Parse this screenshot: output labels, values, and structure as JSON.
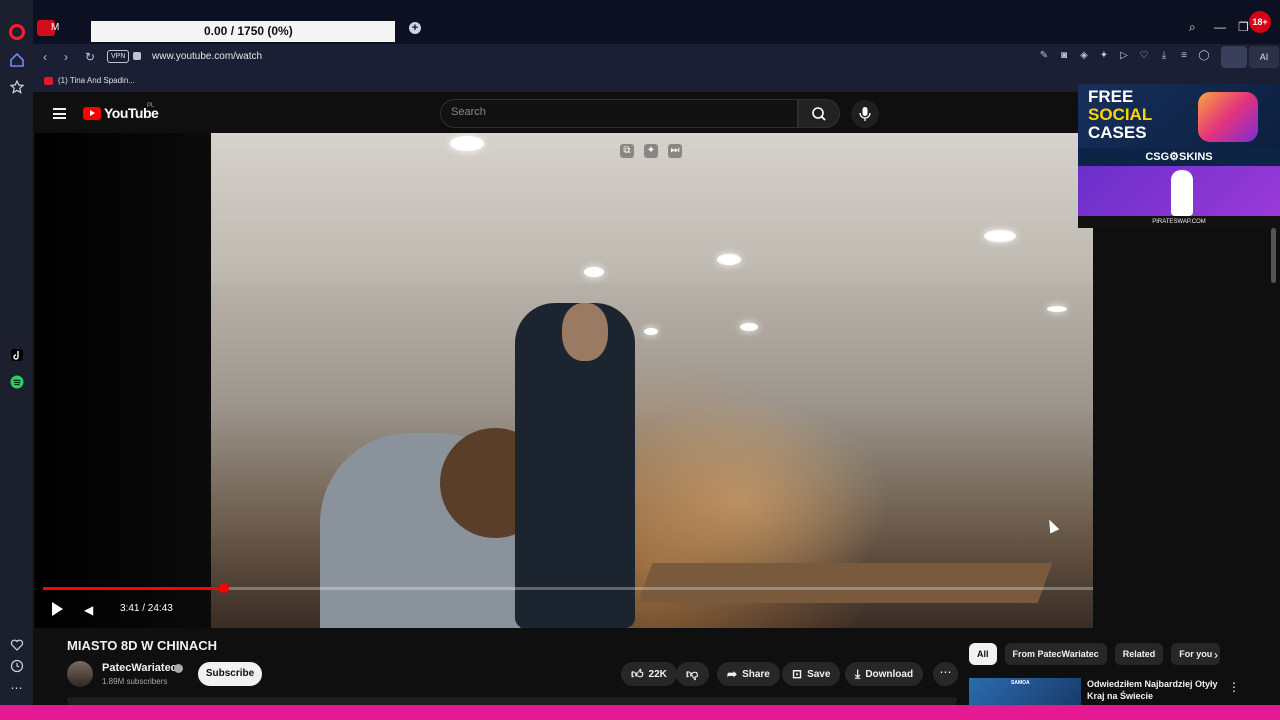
{
  "browser": {
    "overlay_counter": "0.00 / 1750 (0%)",
    "tab_fragment": "M",
    "address_url": "www.youtube.com/watch",
    "vpn_label": "VPN",
    "bookmark_label": "(1) Tina And Spadin...",
    "ai_label": "AI",
    "age_badge": "18+",
    "new_tab": "+"
  },
  "youtube": {
    "logo_text": "YouTube",
    "region": "PL",
    "search_placeholder": "Search"
  },
  "player": {
    "time_display": "3:41 / 24:43",
    "progress_fraction": 0.149
  },
  "ad": {
    "line1": "FREE",
    "line2": "SOCIAL",
    "line3": "CASES",
    "brand": "CSG⚙SKINS",
    "footer": "PIRATESWAP.COM"
  },
  "video": {
    "title": "MIASTO 8D W CHINACH",
    "channel": "PatecWariatec",
    "subscribers": "1.89M subscribers",
    "subscribe_label": "Subscribe",
    "likes": "22K",
    "share_label": "Share",
    "save_label": "Save",
    "download_label": "Download"
  },
  "chips": [
    "All",
    "From PatecWariatec",
    "Related",
    "For you"
  ],
  "recommendation": {
    "title": "Odwiedziłem Najbardziej Otyły Kraj na Świecie",
    "thumb_label": "SAMOA"
  },
  "colors": {
    "accent": "#ff0000",
    "bottom_bar": "#e51a92",
    "opera_red": "#ff1b2d"
  }
}
